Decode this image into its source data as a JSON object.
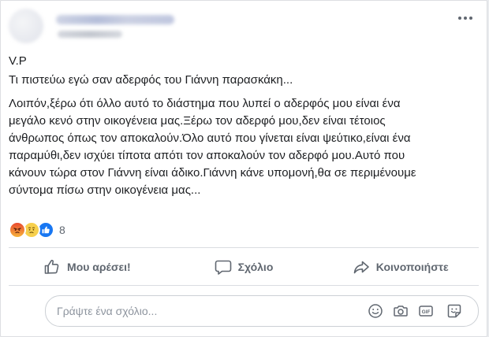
{
  "post": {
    "paragraphs": [
      "V.P",
      "Τι πιστεύω εγώ σαν αδερφός του Γιάννη παρασκάκη...",
      "Λοιπόν,ξέρω ότι όλλο αυτό το διάστημα που λυπεί ο αδερφός μου είναι ένα\nμεγάλο κενό στην οικογένεια μας.Ξέρω τον αδερφό μου,δεν είναι τέτοιος\nάνθρωπος όπως τον αποκαλούν.Όλο αυτό που γίνεται είναι ψεύτικο,είναι ένα\nπαραμύθι,δεν ισχύει τίποτα απότι τον αποκαλούν τον αδερφό μου.Αυτό που\nκάνουν τώρα στον Γιάννη είναι άδικο.Γιάννη κάνε υπομονή,θα σε περιμένουμε\nσύντομα πίσω στην οικογένεια μας..."
    ]
  },
  "reactions": {
    "icons": [
      "angry-icon",
      "sad-icon",
      "like-icon"
    ],
    "count": "8"
  },
  "actions": {
    "like_label": "Μου αρέσει!",
    "comment_label": "Σχόλιο",
    "share_label": "Κοινοποιήστε"
  },
  "comment_box": {
    "placeholder": "Γράψτε ένα σχόλιο...",
    "value": "",
    "icons": [
      "emoji-icon",
      "camera-icon",
      "gif-icon",
      "sticker-icon"
    ]
  },
  "colors": {
    "text": "#1c1e21",
    "muted": "#606770",
    "like_blue": "#1877f2",
    "divider": "#dadde1"
  }
}
